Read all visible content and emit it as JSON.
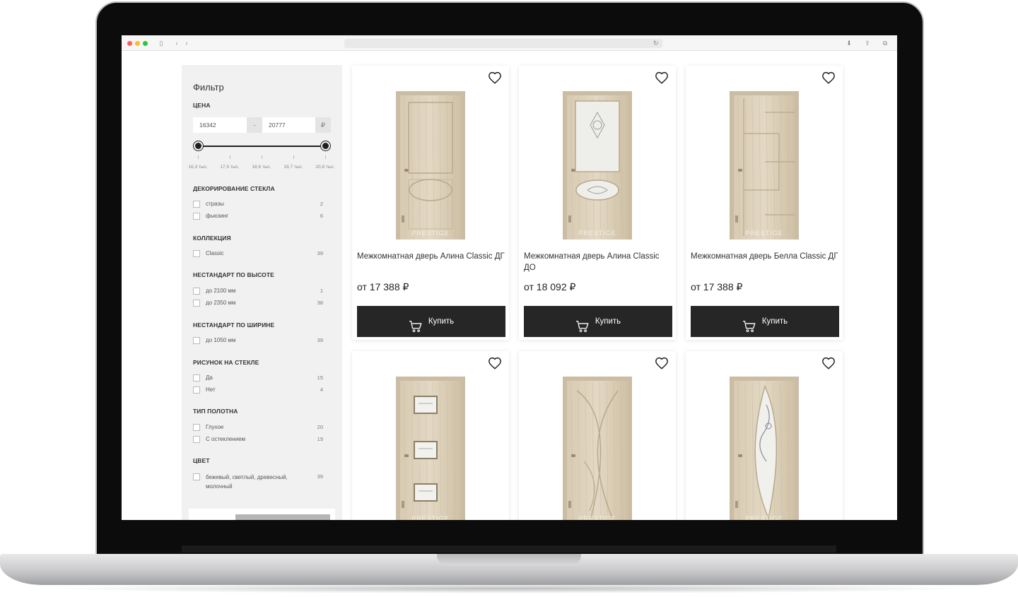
{
  "filter": {
    "title": "Фильтр",
    "price": {
      "label": "ЦЕНА",
      "min": "16342",
      "max": "20777",
      "separator": "-",
      "currency": "₽",
      "ticks": [
        "16,3 тыс.",
        "17,5 тыс.",
        "18,6 тыс.",
        "19,7 тыс.",
        "20,8 тыс."
      ]
    },
    "sections": [
      {
        "title": "ДЕКОРИРОВАНИЕ СТЕКЛА",
        "options": [
          {
            "label": "стразы",
            "count": "2"
          },
          {
            "label": "фьюзинг",
            "count": "6"
          }
        ]
      },
      {
        "title": "КОЛЛЕКЦИЯ",
        "options": [
          {
            "label": "Classic",
            "count": "39"
          }
        ]
      },
      {
        "title": "НЕСТАНДАРТ ПО ВЫСОТЕ",
        "options": [
          {
            "label": "до 2100 мм",
            "count": "1"
          },
          {
            "label": "до 2350 мм",
            "count": "38"
          }
        ]
      },
      {
        "title": "НЕСТАНДАРТ ПО ШИРИНЕ",
        "options": [
          {
            "label": "до 1050 мм",
            "count": "39"
          }
        ]
      },
      {
        "title": "РИСУНОК НА СТЕКЛЕ",
        "options": [
          {
            "label": "Да",
            "count": "15"
          },
          {
            "label": "Нет",
            "count": "4"
          }
        ]
      },
      {
        "title": "ТИП ПОЛОТНА",
        "options": [
          {
            "label": "Глухое",
            "count": "20"
          },
          {
            "label": "С остеклением",
            "count": "19"
          }
        ]
      },
      {
        "title": "ЦВЕТ",
        "options": [
          {
            "label": "бежевый, светлый, древесный,",
            "label2": "молочный",
            "count": "39"
          }
        ]
      }
    ]
  },
  "products": [
    {
      "name": "Межкомнатная дверь Алина Classic ДГ",
      "price": "от 17 388 ₽",
      "buy": "Купить",
      "door": "oval-panel"
    },
    {
      "name": "Межкомнатная дверь Алина Classic ДО",
      "price": "от 18 092 ₽",
      "buy": "Купить",
      "door": "glass-top-oval"
    },
    {
      "name": "Межкомнатная дверь Белла Classic ДГ",
      "price": "от 17 388 ₽",
      "buy": "Купить",
      "door": "grooves"
    },
    {
      "name": "",
      "price": "",
      "buy": "",
      "door": "three-windows"
    },
    {
      "name": "",
      "price": "",
      "buy": "",
      "door": "curves"
    },
    {
      "name": "",
      "price": "",
      "buy": "",
      "door": "curved-glass"
    }
  ],
  "brand_watermark": "PRESTIGE",
  "colors": {
    "button": "#262626",
    "sidebar": "#f1f1f1",
    "door": "#d9cdb6"
  }
}
